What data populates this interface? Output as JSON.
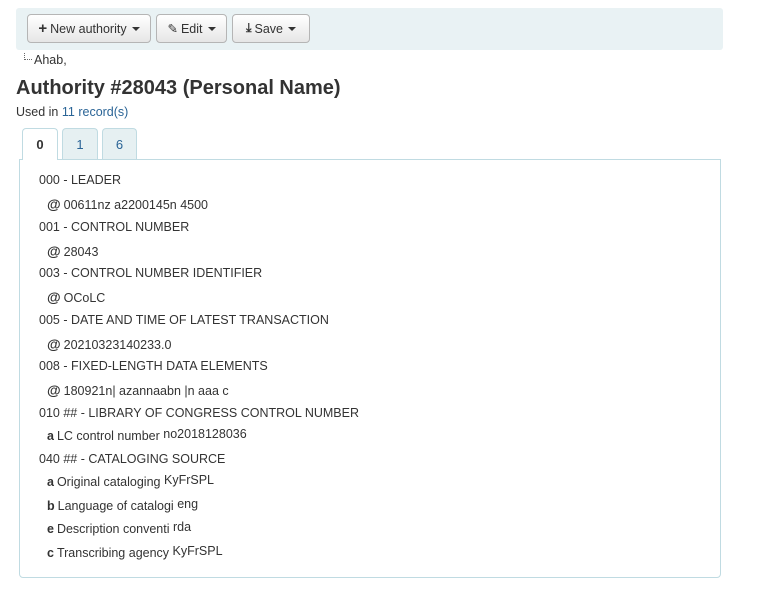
{
  "toolbar": {
    "new_authority": "New authority",
    "edit": "Edit",
    "save": "Save"
  },
  "breadcrumb": "Ahab,",
  "title": "Authority #28043 (Personal Name)",
  "used_in": {
    "prefix": "Used in",
    "link": "11 record(s)"
  },
  "tabs": [
    "0",
    "1",
    "6"
  ],
  "fields": [
    {
      "tag": "000 - LEADER",
      "subfields": [
        {
          "code": "@",
          "label": "",
          "value": "00611nz a2200145n 4500"
        }
      ]
    },
    {
      "tag": "001 - CONTROL NUMBER",
      "subfields": [
        {
          "code": "@",
          "label": "",
          "value": "28043"
        }
      ]
    },
    {
      "tag": "003 - CONTROL NUMBER IDENTIFIER",
      "subfields": [
        {
          "code": "@",
          "label": "",
          "value": "OCoLC"
        }
      ]
    },
    {
      "tag": "005 - DATE AND TIME OF LATEST TRANSACTION",
      "subfields": [
        {
          "code": "@",
          "label": "",
          "value": "20210323140233.0"
        }
      ]
    },
    {
      "tag": "008 - FIXED-LENGTH DATA ELEMENTS",
      "subfields": [
        {
          "code": "@",
          "label": "",
          "value": "180921n| azannaabn |n aaa c"
        }
      ]
    },
    {
      "tag": "010 ## - LIBRARY OF CONGRESS CONTROL NUMBER",
      "subfields": [
        {
          "code": "a",
          "label": "LC control number",
          "value": "no2018128036"
        }
      ]
    },
    {
      "tag": "040 ## - CATALOGING SOURCE",
      "subfields": [
        {
          "code": "a",
          "label": "Original cataloging",
          "value": "KyFrSPL"
        },
        {
          "code": "b",
          "label": "Language of catalogi",
          "value": "eng"
        },
        {
          "code": "e",
          "label": "Description conventi",
          "value": "rda"
        },
        {
          "code": "c",
          "label": "Transcribing agency",
          "value": "KyFrSPL"
        }
      ]
    }
  ]
}
